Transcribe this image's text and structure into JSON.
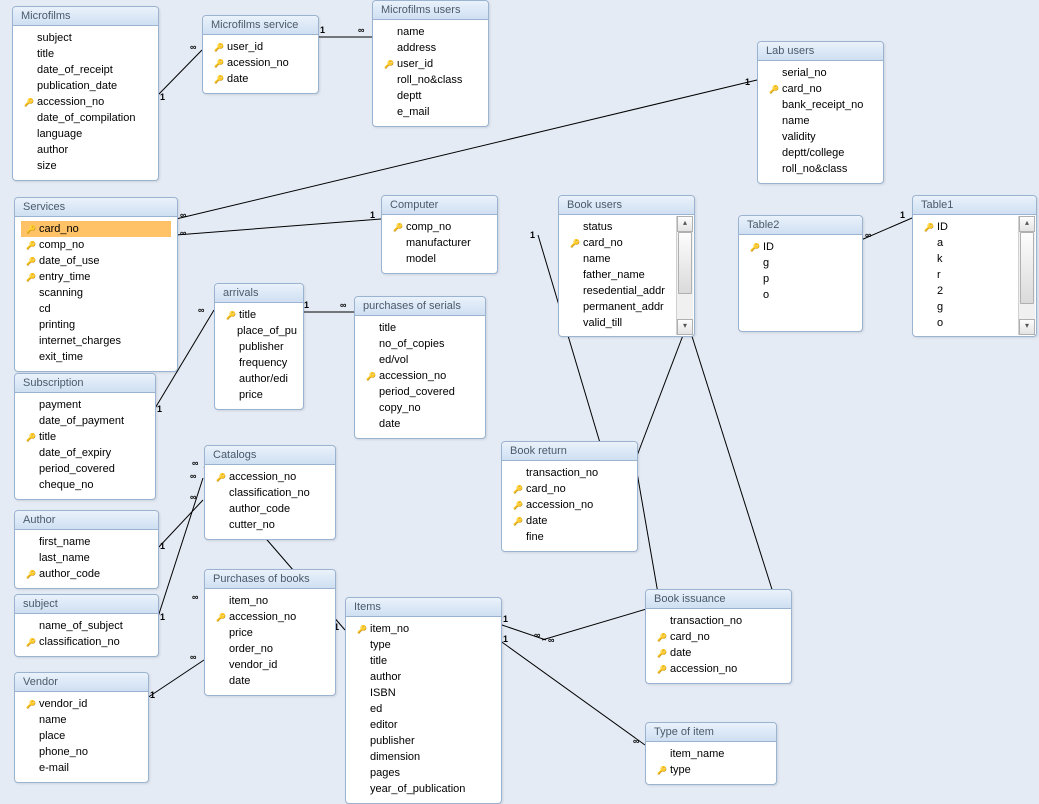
{
  "tables": {
    "microfilms": {
      "title": "Microfilms",
      "fields": [
        {
          "name": "subject",
          "key": false
        },
        {
          "name": "title",
          "key": false
        },
        {
          "name": "date_of_receipt",
          "key": false
        },
        {
          "name": "publication_date",
          "key": false
        },
        {
          "name": "accession_no",
          "key": true
        },
        {
          "name": "date_of_compilation",
          "key": false
        },
        {
          "name": "language",
          "key": false
        },
        {
          "name": "author",
          "key": false
        },
        {
          "name": "size",
          "key": false
        }
      ]
    },
    "microfilms_service": {
      "title": "Microfilms service",
      "fields": [
        {
          "name": "user_id",
          "key": true
        },
        {
          "name": "acession_no",
          "key": true
        },
        {
          "name": "date",
          "key": true
        }
      ]
    },
    "microfilms_users": {
      "title": "Microfilms users",
      "fields": [
        {
          "name": "name",
          "key": false
        },
        {
          "name": "address",
          "key": false
        },
        {
          "name": "user_id",
          "key": true
        },
        {
          "name": "roll_no&class",
          "key": false
        },
        {
          "name": "deptt",
          "key": false
        },
        {
          "name": "e_mail",
          "key": false
        }
      ]
    },
    "lab_users": {
      "title": "Lab users",
      "fields": [
        {
          "name": "serial_no",
          "key": false
        },
        {
          "name": "card_no",
          "key": true
        },
        {
          "name": "bank_receipt_no",
          "key": false
        },
        {
          "name": "name",
          "key": false
        },
        {
          "name": "validity",
          "key": false
        },
        {
          "name": "deptt/college",
          "key": false
        },
        {
          "name": "roll_no&class",
          "key": false
        }
      ]
    },
    "services": {
      "title": "Services",
      "fields": [
        {
          "name": "card_no",
          "key": true,
          "selected": true
        },
        {
          "name": "comp_no",
          "key": true
        },
        {
          "name": "date_of_use",
          "key": true
        },
        {
          "name": "entry_time",
          "key": true
        },
        {
          "name": "scanning",
          "key": false
        },
        {
          "name": "cd",
          "key": false
        },
        {
          "name": "printing",
          "key": false
        },
        {
          "name": "internet_charges",
          "key": false
        },
        {
          "name": "exit_time",
          "key": false
        }
      ]
    },
    "computer": {
      "title": "Computer",
      "fields": [
        {
          "name": "comp_no",
          "key": true
        },
        {
          "name": "manufacturer",
          "key": false
        },
        {
          "name": "model",
          "key": false
        }
      ]
    },
    "book_users": {
      "title": "Book users",
      "fields": [
        {
          "name": "status",
          "key": false
        },
        {
          "name": "card_no",
          "key": true
        },
        {
          "name": "name",
          "key": false
        },
        {
          "name": "father_name",
          "key": false
        },
        {
          "name": "resedential_addr",
          "key": false
        },
        {
          "name": "permanent_addr",
          "key": false
        },
        {
          "name": "valid_till",
          "key": false
        }
      ]
    },
    "table2": {
      "title": "Table2",
      "fields": [
        {
          "name": "ID",
          "key": true
        },
        {
          "name": "g",
          "key": false
        },
        {
          "name": "p",
          "key": false
        },
        {
          "name": "o",
          "key": false
        }
      ]
    },
    "table1": {
      "title": "Table1",
      "fields": [
        {
          "name": "ID",
          "key": true
        },
        {
          "name": "a",
          "key": false
        },
        {
          "name": "k",
          "key": false
        },
        {
          "name": "r",
          "key": false
        },
        {
          "name": "2",
          "key": false
        },
        {
          "name": "g",
          "key": false
        },
        {
          "name": "o",
          "key": false
        }
      ]
    },
    "arrivals": {
      "title": "arrivals",
      "fields": [
        {
          "name": "title",
          "key": true
        },
        {
          "name": "place_of_pu",
          "key": false
        },
        {
          "name": "publisher",
          "key": false
        },
        {
          "name": "frequency",
          "key": false
        },
        {
          "name": "author/edi",
          "key": false
        },
        {
          "name": "price",
          "key": false
        }
      ]
    },
    "purchases_serials": {
      "title": "purchases of serials",
      "fields": [
        {
          "name": "title",
          "key": false
        },
        {
          "name": "no_of_copies",
          "key": false
        },
        {
          "name": "ed/vol",
          "key": false
        },
        {
          "name": "accession_no",
          "key": true
        },
        {
          "name": "period_covered",
          "key": false
        },
        {
          "name": "copy_no",
          "key": false
        },
        {
          "name": "date",
          "key": false
        }
      ]
    },
    "subscription": {
      "title": "Subscription",
      "fields": [
        {
          "name": "payment",
          "key": false
        },
        {
          "name": "date_of_payment",
          "key": false
        },
        {
          "name": "title",
          "key": true
        },
        {
          "name": "date_of_expiry",
          "key": false
        },
        {
          "name": "period_covered",
          "key": false
        },
        {
          "name": "cheque_no",
          "key": false
        }
      ]
    },
    "catalogs": {
      "title": "Catalogs",
      "fields": [
        {
          "name": "accession_no",
          "key": true
        },
        {
          "name": "classification_no",
          "key": false
        },
        {
          "name": "author_code",
          "key": false
        },
        {
          "name": "cutter_no",
          "key": false
        }
      ]
    },
    "book_return": {
      "title": "Book return",
      "fields": [
        {
          "name": "transaction_no",
          "key": false
        },
        {
          "name": "card_no",
          "key": true
        },
        {
          "name": "accession_no",
          "key": true
        },
        {
          "name": "date",
          "key": true
        },
        {
          "name": "fine",
          "key": false
        }
      ]
    },
    "author": {
      "title": "Author",
      "fields": [
        {
          "name": "first_name",
          "key": false
        },
        {
          "name": "last_name",
          "key": false
        },
        {
          "name": "author_code",
          "key": true
        }
      ]
    },
    "subject": {
      "title": "subject",
      "fields": [
        {
          "name": "name_of_subject",
          "key": false
        },
        {
          "name": "classification_no",
          "key": true
        }
      ]
    },
    "purchases_books": {
      "title": "Purchases of books",
      "fields": [
        {
          "name": "item_no",
          "key": false
        },
        {
          "name": "accession_no",
          "key": true
        },
        {
          "name": "price",
          "key": false
        },
        {
          "name": "order_no",
          "key": false
        },
        {
          "name": "vendor_id",
          "key": false
        },
        {
          "name": "date",
          "key": false
        }
      ]
    },
    "items": {
      "title": "Items",
      "fields": [
        {
          "name": "item_no",
          "key": true
        },
        {
          "name": "type",
          "key": false
        },
        {
          "name": "title",
          "key": false
        },
        {
          "name": "author",
          "key": false
        },
        {
          "name": "ISBN",
          "key": false
        },
        {
          "name": "ed",
          "key": false
        },
        {
          "name": "editor",
          "key": false
        },
        {
          "name": "publisher",
          "key": false
        },
        {
          "name": "dimension",
          "key": false
        },
        {
          "name": "pages",
          "key": false
        },
        {
          "name": "year_of_publication",
          "key": false
        }
      ]
    },
    "book_issuance": {
      "title": "Book issuance",
      "fields": [
        {
          "name": "transaction_no",
          "key": false
        },
        {
          "name": "card_no",
          "key": true
        },
        {
          "name": "date",
          "key": true
        },
        {
          "name": "accession_no",
          "key": true
        }
      ]
    },
    "type_of_item": {
      "title": "Type of item",
      "fields": [
        {
          "name": "item_name",
          "key": false
        },
        {
          "name": "type",
          "key": true
        }
      ]
    },
    "vendor": {
      "title": "Vendor",
      "fields": [
        {
          "name": "vendor_id",
          "key": true
        },
        {
          "name": "name",
          "key": false
        },
        {
          "name": "place",
          "key": false
        },
        {
          "name": "phone_no",
          "key": false
        },
        {
          "name": "e-mail",
          "key": false
        }
      ]
    }
  }
}
